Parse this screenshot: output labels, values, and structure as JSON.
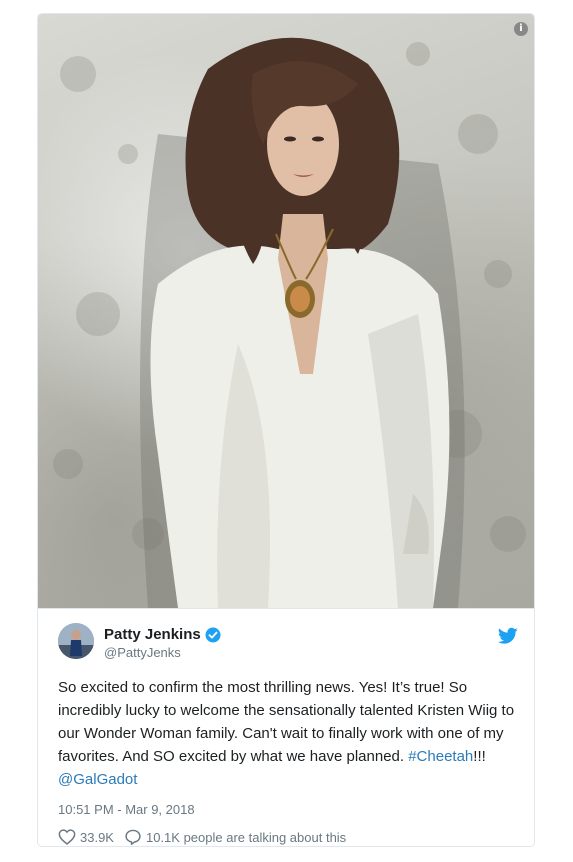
{
  "media": {
    "info_icon_glyph": "i",
    "background_color": "#c8c8c2"
  },
  "tweet": {
    "display_name": "Patty Jenkins",
    "handle": "@PattyJenks",
    "verified": true,
    "text_parts": {
      "body": "So excited to confirm the most thrilling news. Yes! It’s true! So incredibly lucky to welcome the sensationally talented Kristen Wiig to our Wonder Woman family. Can't wait to finally work with one of my favorites. And SO excited by what we have planned.",
      "hashtag": "#Cheetah",
      "exclaim": "!!! ",
      "mention": "@GalGadot"
    },
    "timestamp": "10:51 PM - Mar 9, 2018",
    "likes": "33.9K",
    "talking": "10.1K people are talking about this"
  },
  "colors": {
    "link": "#2b7bb9",
    "text": "#1c2022",
    "secondary": "#697882",
    "verified": "#1da1f2",
    "twitter": "#1da1f2"
  },
  "icons": {
    "verified": "verified-badge-icon",
    "bird": "twitter-bird-icon",
    "heart": "heart-icon",
    "reply": "reply-bubble-icon",
    "info": "info-icon"
  }
}
